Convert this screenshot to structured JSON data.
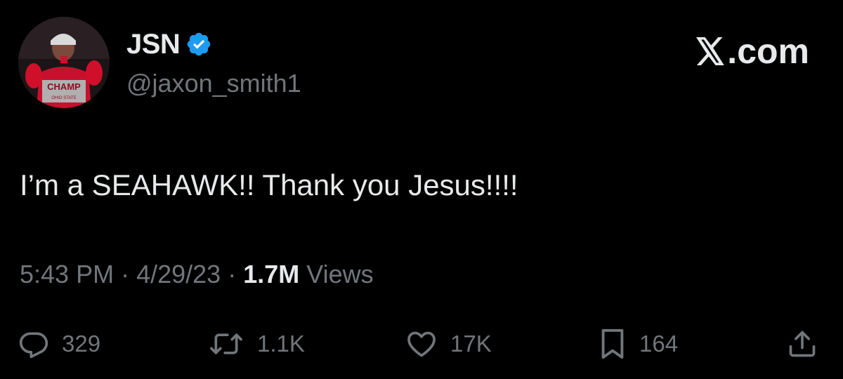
{
  "author": {
    "display_name": "JSN",
    "handle": "@jaxon_smith1",
    "verified": true,
    "avatar_shirt_text": "CHAMP",
    "avatar_shirt_subtext": "OHIO STATE"
  },
  "brand": {
    "label": ".com"
  },
  "tweet": {
    "text": "I’m a SEAHAWK!! Thank you Jesus!!!!"
  },
  "meta": {
    "time": "5:43 PM",
    "separator": " · ",
    "date": "4/29/23",
    "views_count": "1.7M",
    "views_label": "Views"
  },
  "actions": {
    "replies": "329",
    "reposts": "1.1K",
    "likes": "17K",
    "bookmarks": "164"
  },
  "colors": {
    "background": "#000000",
    "primary_text": "#e7e9ea",
    "secondary_text": "#71767b",
    "verified_blue": "#1d9bf0"
  }
}
